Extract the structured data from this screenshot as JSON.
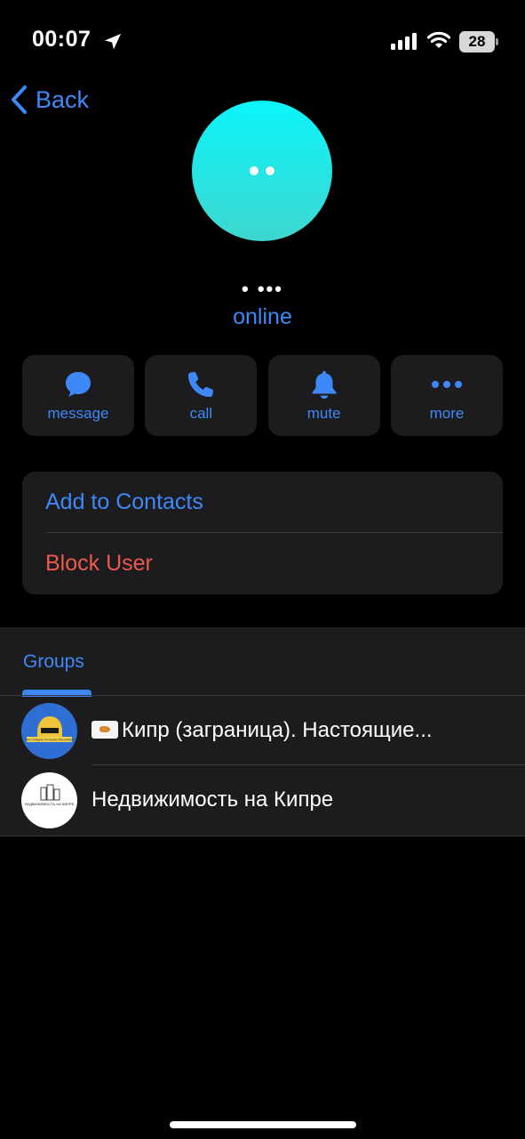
{
  "status_bar": {
    "time": "00:07",
    "battery": "28"
  },
  "nav": {
    "back_label": "Back"
  },
  "profile": {
    "name": "• •••",
    "status": "online"
  },
  "actions": [
    {
      "label": "message",
      "icon": "message-bubble-icon"
    },
    {
      "label": "call",
      "icon": "phone-icon"
    },
    {
      "label": "mute",
      "icon": "bell-icon"
    },
    {
      "label": "more",
      "icon": "more-dots-icon"
    }
  ],
  "contact_card": {
    "add_label": "Add to Contacts",
    "block_label": "Block User"
  },
  "groups": {
    "tab_label": "Groups",
    "items": [
      {
        "title": "Кипр (заграница). Настоящие...",
        "avatar_text": "НАСТОЯЩИЕ ПУТЕШЕСТВЕННИКИ"
      },
      {
        "title": "Недвижимость на Кипре",
        "avatar_text": "НЕДВИЖИМОСТЬ НА КИПРЕ"
      }
    ]
  },
  "colors": {
    "accent": "#3e88f7",
    "destructive": "#ec5a4d",
    "card": "#1c1c1e",
    "avatar_top": "#0cf5fb",
    "avatar_bottom": "#3fd6cf"
  }
}
